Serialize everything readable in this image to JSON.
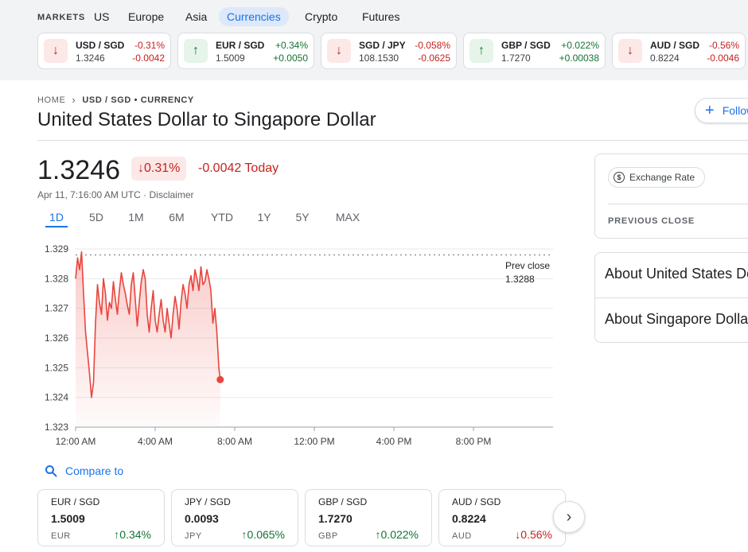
{
  "markets": {
    "label": "MARKETS",
    "tabs": [
      {
        "label": "US"
      },
      {
        "label": "Europe"
      },
      {
        "label": "Asia"
      },
      {
        "label": "Currencies",
        "active": true
      },
      {
        "label": "Crypto"
      },
      {
        "label": "Futures"
      }
    ]
  },
  "tickers": [
    {
      "pair": "USD / SGD",
      "price": "1.3246",
      "pct": "-0.31%",
      "change": "-0.0042",
      "direction": "down"
    },
    {
      "pair": "EUR / SGD",
      "price": "1.5009",
      "pct": "+0.34%",
      "change": "+0.0050",
      "direction": "up"
    },
    {
      "pair": "SGD / JPY",
      "price": "108.1530",
      "pct": "-0.058%",
      "change": "-0.0625",
      "direction": "down"
    },
    {
      "pair": "GBP / SGD",
      "price": "1.7270",
      "pct": "+0.022%",
      "change": "+0.00038",
      "direction": "up"
    },
    {
      "pair": "AUD / SGD",
      "price": "0.8224",
      "pct": "-0.56%",
      "change": "-0.0046",
      "direction": "down"
    }
  ],
  "breadcrumb": {
    "home": "HOME",
    "current": "USD / SGD • CURRENCY"
  },
  "title": "United States Dollar to Singapore Dollar",
  "follow_label": "Follow",
  "quote": {
    "price": "1.3246",
    "pct": "0.31%",
    "change_today": "-0.0042 Today",
    "timestamp": "Apr 11, 7:16:00 AM UTC · Disclaimer"
  },
  "range_tabs": [
    "1D",
    "5D",
    "1M",
    "6M",
    "YTD",
    "1Y",
    "5Y",
    "MAX"
  ],
  "chart_data": {
    "type": "line",
    "y_ticks": [
      "1.329",
      "1.328",
      "1.327",
      "1.326",
      "1.325",
      "1.324",
      "1.323"
    ],
    "ylim": [
      1.323,
      1.329
    ],
    "x_ticks": [
      "12:00 AM",
      "4:00 AM",
      "8:00 AM",
      "12:00 PM",
      "4:00 PM",
      "8:00 PM"
    ],
    "prev_close": {
      "label": "Prev close",
      "value": 1.3288
    },
    "series": [
      {
        "x": [
          0.0,
          0.1,
          0.2,
          0.3,
          0.4,
          0.5,
          0.6,
          0.7,
          0.8,
          0.9,
          1.0,
          1.1,
          1.2,
          1.3,
          1.4,
          1.5,
          1.6,
          1.7,
          1.8,
          1.9,
          2.0,
          2.1,
          2.2,
          2.3,
          2.4,
          2.5,
          2.6,
          2.7,
          2.8,
          2.9,
          3.0,
          3.1,
          3.2,
          3.3,
          3.4,
          3.5,
          3.6,
          3.7,
          3.8,
          3.9,
          4.0,
          4.1,
          4.2,
          4.3,
          4.4,
          4.5,
          4.6,
          4.7,
          4.8,
          4.9,
          5.0,
          5.1,
          5.2,
          5.3,
          5.4,
          5.5,
          5.6,
          5.7,
          5.8,
          5.9,
          6.0,
          6.1,
          6.2,
          6.3,
          6.4,
          6.5,
          6.6,
          6.7,
          6.8,
          6.9,
          7.0,
          7.1,
          7.2,
          7.27
        ],
        "y": [
          1.328,
          1.3287,
          1.3283,
          1.3289,
          1.3275,
          1.3262,
          1.3255,
          1.3248,
          1.324,
          1.3245,
          1.3265,
          1.3278,
          1.3272,
          1.3268,
          1.328,
          1.3275,
          1.3266,
          1.3272,
          1.327,
          1.3279,
          1.3273,
          1.3268,
          1.3276,
          1.3282,
          1.3278,
          1.3275,
          1.3271,
          1.3268,
          1.3278,
          1.3282,
          1.3273,
          1.3264,
          1.3272,
          1.3279,
          1.3283,
          1.328,
          1.3268,
          1.3262,
          1.327,
          1.3276,
          1.3266,
          1.3262,
          1.3268,
          1.3273,
          1.3266,
          1.3262,
          1.327,
          1.3265,
          1.326,
          1.3268,
          1.3274,
          1.327,
          1.3263,
          1.3272,
          1.3278,
          1.3275,
          1.327,
          1.3278,
          1.3281,
          1.3276,
          1.3283,
          1.328,
          1.3276,
          1.3284,
          1.3278,
          1.3279,
          1.3283,
          1.328,
          1.3276,
          1.3265,
          1.327,
          1.3262,
          1.325,
          1.3246
        ]
      }
    ]
  },
  "compare": {
    "label": "Compare to",
    "cards": [
      {
        "pair": "EUR / SGD",
        "price": "1.5009",
        "code": "EUR",
        "pct": "0.34%",
        "direction": "up"
      },
      {
        "pair": "JPY / SGD",
        "price": "0.0093",
        "code": "JPY",
        "pct": "0.065%",
        "direction": "up"
      },
      {
        "pair": "GBP / SGD",
        "price": "1.7270",
        "code": "GBP",
        "pct": "0.022%",
        "direction": "up"
      },
      {
        "pair": "AUD / SGD",
        "price": "0.8224",
        "code": "AUD",
        "pct": "0.56%",
        "direction": "down"
      }
    ]
  },
  "side": {
    "exchange_rate_label": "Exchange Rate",
    "previous_close_label": "PREVIOUS CLOSE",
    "about_usd": "About United States Dollar",
    "about_sgd": "About Singapore Dollar"
  },
  "colors": {
    "accent": "#1a73e8",
    "negative": "#c5221f",
    "positive": "#137333",
    "line": "#e8453c"
  }
}
